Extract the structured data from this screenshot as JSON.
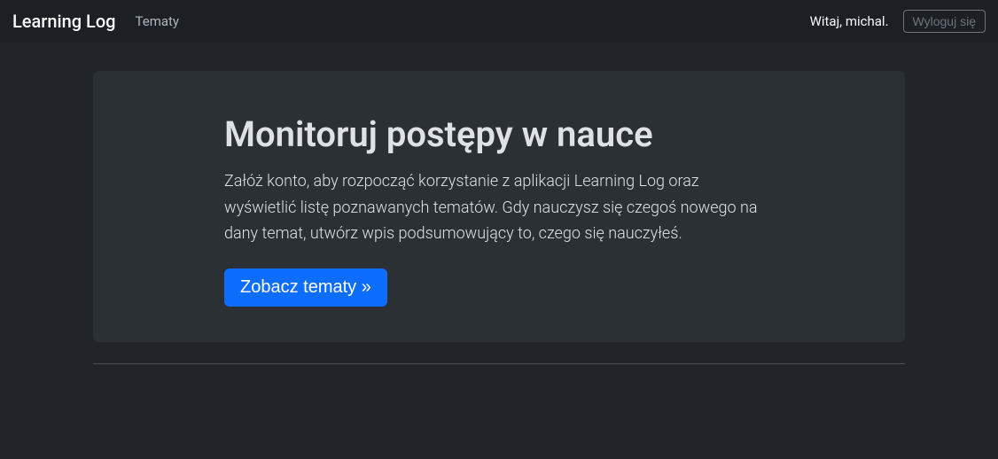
{
  "navbar": {
    "brand": "Learning Log",
    "links": {
      "topics": "Tematy"
    },
    "welcome": "Witaj, michal.",
    "logout": "Wyloguj się"
  },
  "jumbotron": {
    "title": "Monitoruj postępy w nauce",
    "lead": "Załóż konto, aby rozpocząć korzystanie z aplikacji Learning Log oraz wyświetlić listę poznawanych tematów. Gdy nauczysz się czegoś nowego na dany temat, utwórz wpis podsumowujący to, czego się nauczyłeś.",
    "cta": "Zobacz tematy »"
  }
}
